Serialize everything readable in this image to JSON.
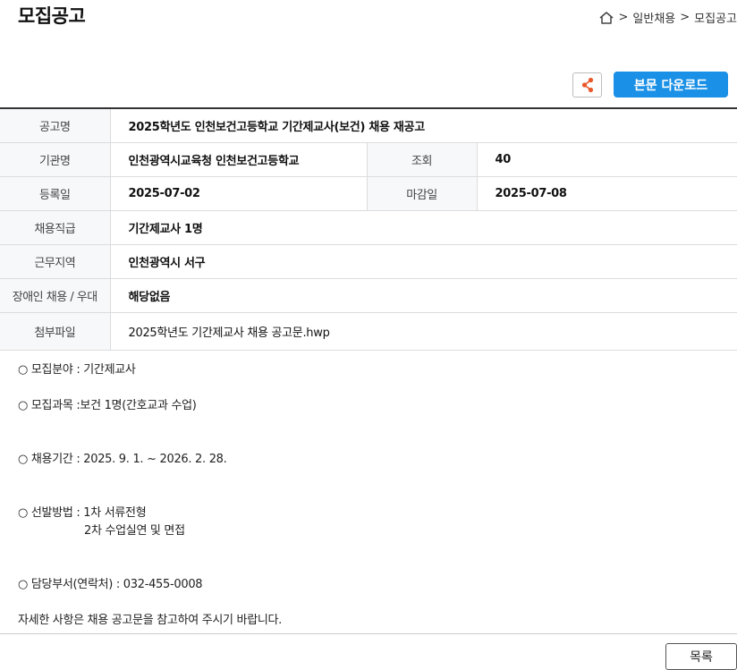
{
  "page": {
    "title": "모집공고"
  },
  "breadcrumb": {
    "home_icon": "home-icon",
    "separator": ">",
    "items": [
      "일반채용",
      "모집공고"
    ]
  },
  "actions": {
    "share_icon": "share-icon",
    "download_label": "본문 다운로드"
  },
  "colors": {
    "accent": "#1a90e6",
    "share_icon": "#e8582a"
  },
  "info": {
    "title_label": "공고명",
    "title_value": "2025학년도 인천보건고등학교 기간제교사(보건) 채용 재공고",
    "org_label": "기관명",
    "org_value": "인천광역시교육청 인천보건고등학교",
    "views_label": "조회",
    "views_value": "40",
    "reg_label": "등록일",
    "reg_value": "2025-07-02",
    "deadline_label": "마감일",
    "deadline_value": "2025-07-08",
    "rank_label": "채용직급",
    "rank_value": "기간제교사 1명",
    "region_label": "근무지역",
    "region_value": "인천광역시 서구",
    "disabled_label": "장애인 채용 / 우대",
    "disabled_value": "해당없음",
    "attach_label": "첨부파일",
    "attach_value": "2025학년도 기간제교사 채용 공고문.hwp"
  },
  "content": {
    "field": "○ 모집분야 : 기간제교사",
    "subject": "○ 모집과목 :보건 1명(간호교과 수업)",
    "period": "○ 채용기간 : 2025. 9. 1. ~ 2026. 2. 28.",
    "method": "○ 선발방법 : 1차 서류전형",
    "method_2": "2차 수업실연 및 면접",
    "contact": "○ 담당부서(연락처) : 032-455-0008",
    "note": "자세한 사항은 채용 공고문을 참고하여 주시기 바랍니다."
  },
  "footer": {
    "list_label": "목록"
  }
}
